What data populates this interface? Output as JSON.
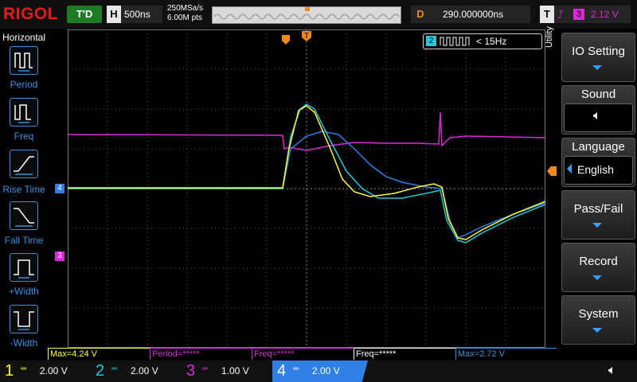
{
  "top": {
    "logo": "RIGOL",
    "trigger_status": "T'D",
    "horizontal": {
      "label": "H",
      "timebase": "500ns"
    },
    "acquisition": {
      "sample_rate": "250MSa/s",
      "memory_depth": "6.00M pts"
    },
    "delay": {
      "label": "D",
      "value": "290.000000ns"
    },
    "trigger": {
      "label": "T",
      "source": "3",
      "level": "2.12 V"
    }
  },
  "left_menu": {
    "title": "Horizontal",
    "items": [
      {
        "label": "Period"
      },
      {
        "label": "Freq"
      },
      {
        "label": "Rise Time"
      },
      {
        "label": "Fall Time"
      },
      {
        "label": "+Width"
      },
      {
        "label": "-Width"
      }
    ]
  },
  "screen": {
    "freq_counter": {
      "channel": "2",
      "value": "< 15Hz"
    },
    "markers": {
      "trigger_pos": "T",
      "ch4": "4",
      "ch3": "3"
    }
  },
  "right_menu": {
    "side_label": "Utility",
    "items": [
      {
        "label": "IO Setting",
        "has_arrow": true
      },
      {
        "label": "Sound",
        "has_box": true
      },
      {
        "label": "Language",
        "value": "English"
      },
      {
        "label": "Pass/Fail",
        "has_arrow": true
      },
      {
        "label": "Record",
        "has_arrow": true
      },
      {
        "label": "System",
        "has_arrow": true
      }
    ]
  },
  "measurements": [
    {
      "text": "Max=4.24 V",
      "color": "#ffff33"
    },
    {
      "text": "Period=*****",
      "color": "#d72ad7"
    },
    {
      "text": "Freq=*****",
      "color": "#d72ad7"
    },
    {
      "text": "Freq=*****",
      "color": "#ffffff"
    },
    {
      "text": "Max=2.72 V",
      "color": "#3a8fd0"
    }
  ],
  "channels": [
    {
      "num": "1",
      "scale": "2.00 V",
      "color": "#ffff33"
    },
    {
      "num": "2",
      "scale": "2.00 V",
      "color": "#22c7d9"
    },
    {
      "num": "3",
      "scale": "1.00 V",
      "color": "#d72ad7"
    },
    {
      "num": "4",
      "scale": "2.00 V",
      "color": "#2f7fe6"
    }
  ],
  "colors": {
    "ch1": "#ffff33",
    "ch2": "#22c7d9",
    "ch3": "#d72ad7",
    "ch4": "#2f7fe6",
    "trigger_marker": "#f08a1c",
    "run_green": "#1d7a25"
  }
}
